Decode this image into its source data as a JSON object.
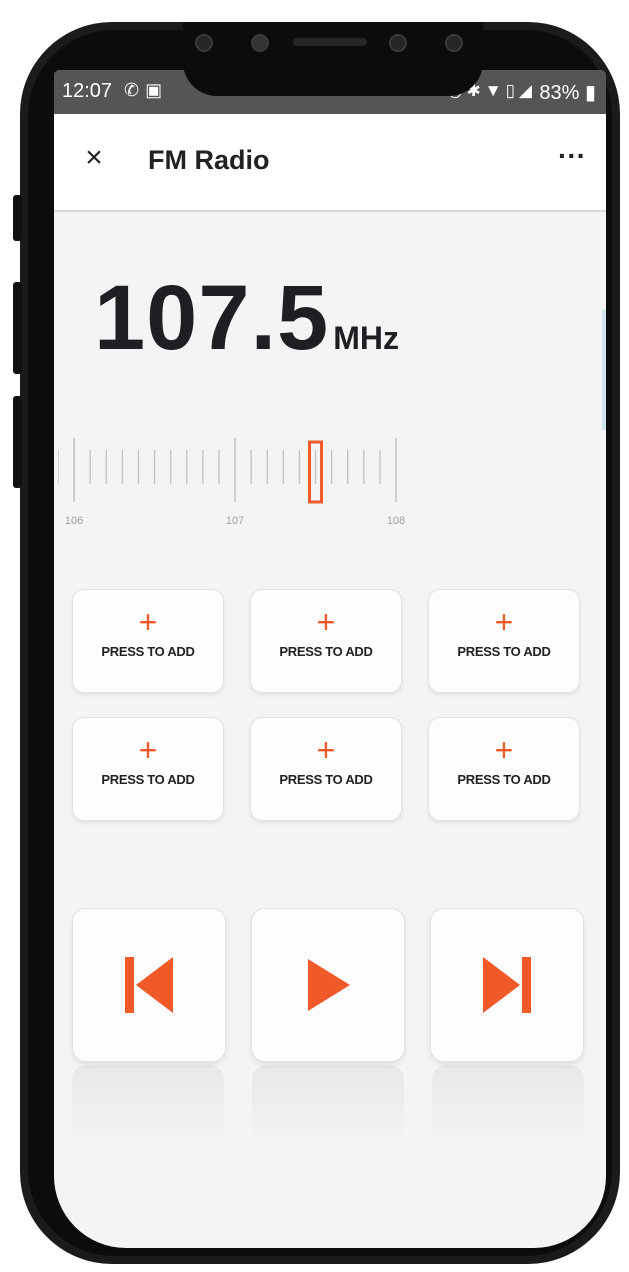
{
  "status_bar": {
    "time": "12:07",
    "left_icons": [
      "whatsapp-icon",
      "image-icon"
    ],
    "right_icons": [
      "alarm-icon",
      "vibrate-icon",
      "wifi-icon",
      "no-sim-icon",
      "signal-icon"
    ],
    "battery": "83%"
  },
  "app_bar": {
    "close_label": "×",
    "title": "FM Radio",
    "more_label": "···"
  },
  "frequency": {
    "value": "107.5",
    "unit": "MHz"
  },
  "tuner": {
    "labels": [
      "106",
      "107",
      "108"
    ],
    "current": 107.5,
    "min": 105.9,
    "max": 108.0,
    "accent": "#f05a28"
  },
  "presets": [
    {
      "plus": "+",
      "label": "PRESS TO ADD"
    },
    {
      "plus": "+",
      "label": "PRESS TO ADD"
    },
    {
      "plus": "+",
      "label": "PRESS TO ADD"
    },
    {
      "plus": "+",
      "label": "PRESS TO ADD"
    },
    {
      "plus": "+",
      "label": "PRESS TO ADD"
    },
    {
      "plus": "+",
      "label": "PRESS TO ADD"
    }
  ],
  "controls": {
    "previous_icon": "skip-previous-icon",
    "play_icon": "play-icon",
    "next_icon": "skip-next-icon",
    "accent": "#f05a28"
  }
}
